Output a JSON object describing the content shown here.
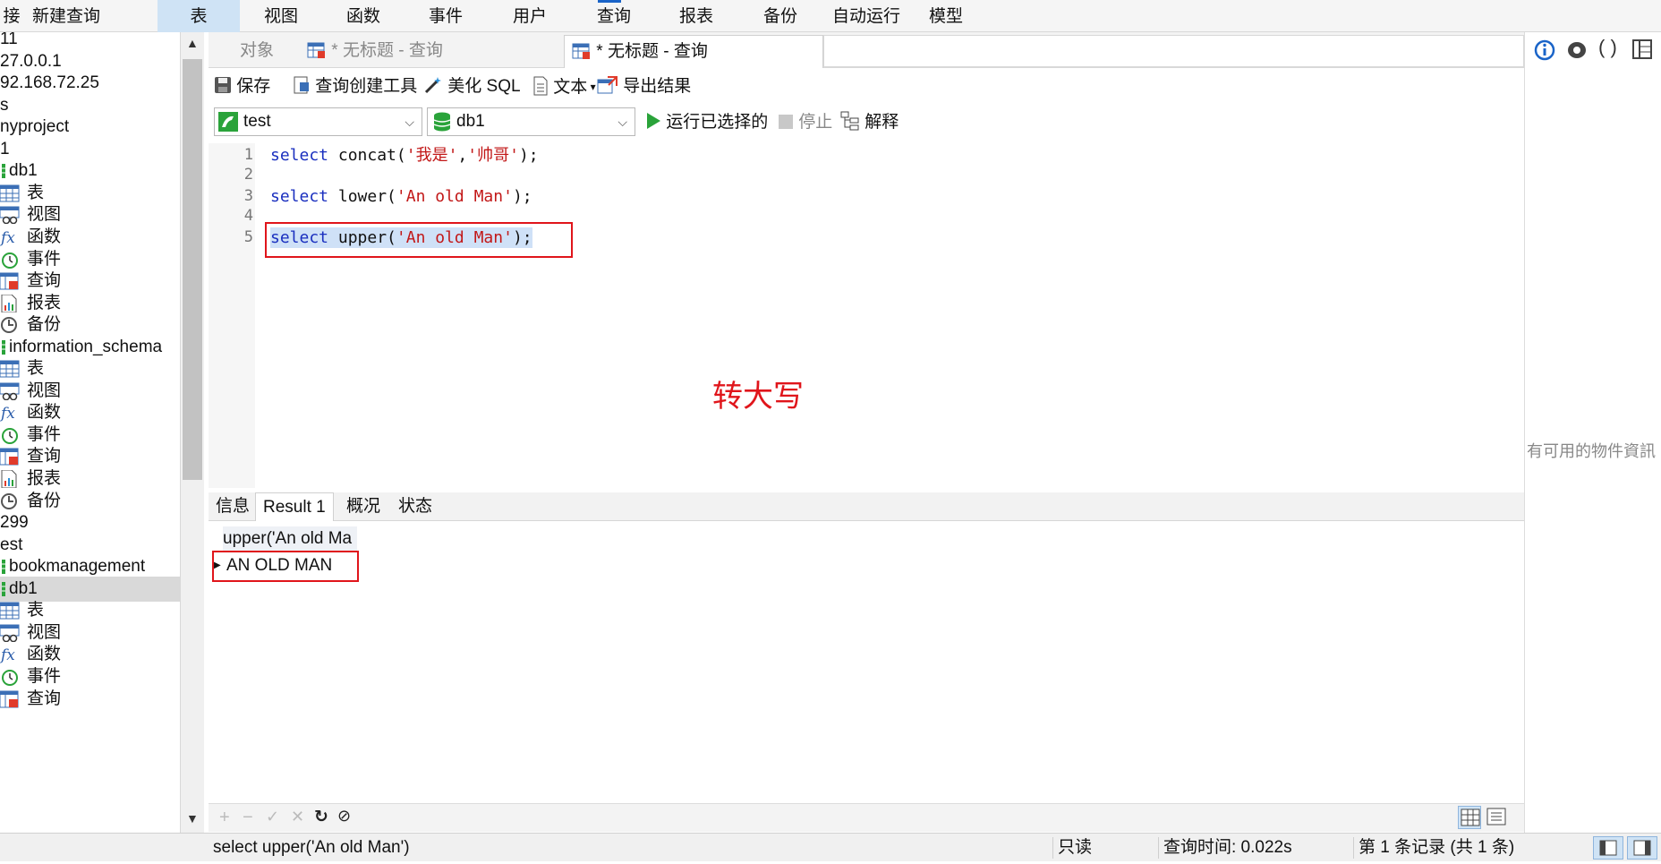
{
  "menu": {
    "items": [
      {
        "label": "接"
      },
      {
        "label": "新建查询"
      },
      {
        "label": "表"
      },
      {
        "label": "视图"
      },
      {
        "label": "函数"
      },
      {
        "label": "事件"
      },
      {
        "label": "用户"
      },
      {
        "label": "查询"
      },
      {
        "label": "报表"
      },
      {
        "label": "备份"
      },
      {
        "label": "自动运行"
      },
      {
        "label": "模型"
      }
    ],
    "active": "表"
  },
  "sidebar": {
    "items": [
      {
        "label": "11",
        "icon": "none"
      },
      {
        "label": "27.0.0.1",
        "icon": "none"
      },
      {
        "label": "92.168.72.25",
        "icon": "none"
      },
      {
        "label": "s",
        "icon": "none"
      },
      {
        "label": "nyproject",
        "icon": "none"
      },
      {
        "label": "1",
        "icon": "none"
      },
      {
        "label": "db1",
        "icon": "database-icon"
      },
      {
        "label": "表",
        "icon": "table-icon"
      },
      {
        "label": "视图",
        "icon": "view-icon"
      },
      {
        "label": "函数",
        "icon": "function-icon"
      },
      {
        "label": "事件",
        "icon": "event-icon"
      },
      {
        "label": "查询",
        "icon": "query-icon"
      },
      {
        "label": "报表",
        "icon": "report-icon"
      },
      {
        "label": "备份",
        "icon": "backup-icon"
      },
      {
        "label": "information_schema",
        "icon": "database-icon"
      },
      {
        "label": "表",
        "icon": "table-icon"
      },
      {
        "label": "视图",
        "icon": "view-icon"
      },
      {
        "label": "函数",
        "icon": "function-icon"
      },
      {
        "label": "事件",
        "icon": "event-icon"
      },
      {
        "label": "查询",
        "icon": "query-icon"
      },
      {
        "label": "报表",
        "icon": "report-icon"
      },
      {
        "label": "备份",
        "icon": "backup-icon"
      },
      {
        "label": "299",
        "icon": "none"
      },
      {
        "label": "est",
        "icon": "none"
      },
      {
        "label": "bookmanagement",
        "icon": "database-icon"
      },
      {
        "label": "db1",
        "icon": "database-icon",
        "selected": true
      },
      {
        "label": "表",
        "icon": "table-icon"
      },
      {
        "label": "视图",
        "icon": "view-icon"
      },
      {
        "label": "函数",
        "icon": "function-icon"
      },
      {
        "label": "事件",
        "icon": "event-icon"
      },
      {
        "label": "查询",
        "icon": "query-icon"
      }
    ]
  },
  "tabs": {
    "objects": "对象",
    "tab1": "* 无标题 - 查询",
    "tab2": "* 无标题 - 查询"
  },
  "toolbar": {
    "save": "保存",
    "query_builder": "查询创建工具",
    "beautify": "美化 SQL",
    "text": "文本",
    "export": "导出结果",
    "connection": "test",
    "database": "db1",
    "run_selected": "运行已选择的",
    "stop": "停止",
    "explain": "解释"
  },
  "editor": {
    "lines": [
      {
        "num": "1",
        "kw": "select",
        "fn": " concat(",
        "s1": "'我是'",
        "mid": ",",
        "s2": "'帅哥'",
        "end": ");"
      },
      {
        "num": "2"
      },
      {
        "num": "3",
        "kw": "select",
        "fn": " lower(",
        "s1": "'An old Man'",
        "end": ");"
      },
      {
        "num": "4"
      },
      {
        "num": "5",
        "kw": "select",
        "fn": " upper(",
        "s1": "'An old Man'",
        "end": ");"
      }
    ],
    "annotation": "转大写"
  },
  "result": {
    "tabs": [
      "信息",
      "Result 1",
      "概况",
      "状态"
    ],
    "active_tab": "Result 1",
    "column": "upper('An old Ma",
    "value": "AN OLD MAN"
  },
  "status": {
    "sql": "select upper('An old Man')",
    "readonly": "只读",
    "time": "查询时间: 0.022s",
    "records": "第 1 条记录 (共 1 条)"
  },
  "rightpanel": {
    "message": "有可用的物件資訊"
  },
  "colors": {
    "accent": "#cfe3f5",
    "annotation": "#e0151b",
    "keyword": "#1a2fbf",
    "string": "#c21818"
  }
}
